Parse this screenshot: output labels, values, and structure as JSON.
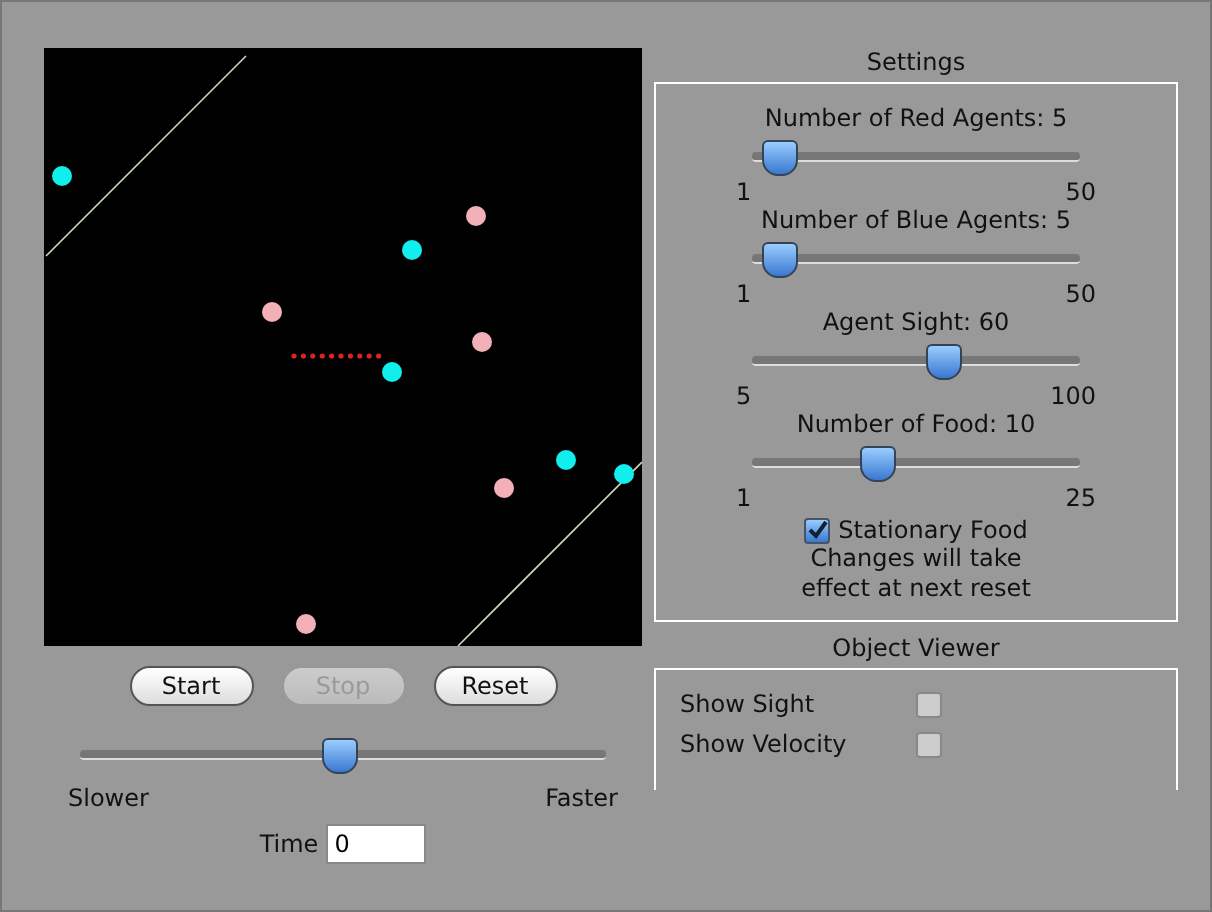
{
  "settings": {
    "title": "Settings",
    "sliders": [
      {
        "label": "Number of Red Agents: 5",
        "level": 0.08,
        "min": "1",
        "max": "50"
      },
      {
        "label": "Number of Blue Agents: 5",
        "level": 0.08,
        "min": "1",
        "max": "50"
      },
      {
        "label": "Agent Sight: 60",
        "level": 0.58,
        "min": "5",
        "max": "100"
      },
      {
        "label": "Number of Food: 10",
        "level": 0.375,
        "min": "1",
        "max": "25"
      }
    ],
    "stationary_food": {
      "label": "Stationary Food",
      "checked": true
    },
    "note": "Changes will take effect at next reset"
  },
  "object_viewer": {
    "title": "Object Viewer",
    "options": [
      {
        "label": "Show Sight",
        "checked": false
      },
      {
        "label": "Show Velocity",
        "checked": false
      }
    ]
  },
  "buttons": [
    {
      "label": "Start",
      "disabled": false
    },
    {
      "label": "Stop",
      "disabled": true
    },
    {
      "label": "Reset",
      "disabled": false
    }
  ],
  "speed": {
    "level": 0.49,
    "min_label": "Slower",
    "max_label": "Faster"
  },
  "time": {
    "label": "Time",
    "value": "0"
  }
}
